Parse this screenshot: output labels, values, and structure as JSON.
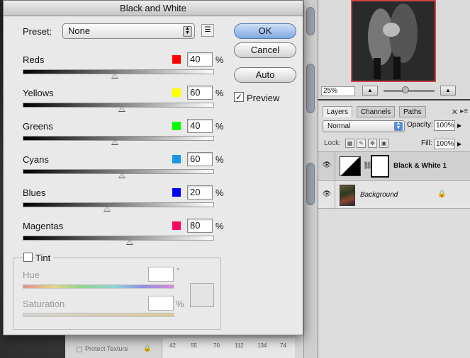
{
  "dialog": {
    "title": "Black and White",
    "preset_label": "Preset:",
    "preset_value": "None",
    "buttons": {
      "ok": "OK",
      "cancel": "Cancel",
      "auto": "Auto"
    },
    "preview_label": "Preview",
    "preview_checked": true,
    "percent_sign": "%",
    "channels": [
      {
        "name": "Reds",
        "value": "40",
        "color": "#ff0000"
      },
      {
        "name": "Yellows",
        "value": "60",
        "color": "#ffff00"
      },
      {
        "name": "Greens",
        "value": "40",
        "color": "#00ff00"
      },
      {
        "name": "Cyans",
        "value": "60",
        "color": "#1a96e6"
      },
      {
        "name": "Blues",
        "value": "20",
        "color": "#0000ff"
      },
      {
        "name": "Magentas",
        "value": "80",
        "color": "#ff0066"
      }
    ],
    "tint": {
      "label": "Tint",
      "checked": false,
      "hue_label": "Hue",
      "hue_unit": "°",
      "saturation_label": "Saturation",
      "saturation_unit": "%"
    }
  },
  "navigator": {
    "zoom": "25%"
  },
  "layers_panel": {
    "tabs": [
      "Layers",
      "Channels",
      "Paths"
    ],
    "active_tab": "Layers",
    "blend_mode": "Normal",
    "opacity_label": "Opacity:",
    "opacity_value": "100%",
    "lock_label": "Lock:",
    "fill_label": "Fill:",
    "fill_value": "100%",
    "layers": [
      {
        "name": "Black & White 1",
        "selected": true
      },
      {
        "name": "Background",
        "locked": true
      }
    ]
  },
  "background_panel": {
    "protect_texture_label": "Protect Texture",
    "ruler_values": [
      "42",
      "55",
      "70",
      "112",
      "134",
      "74"
    ]
  }
}
